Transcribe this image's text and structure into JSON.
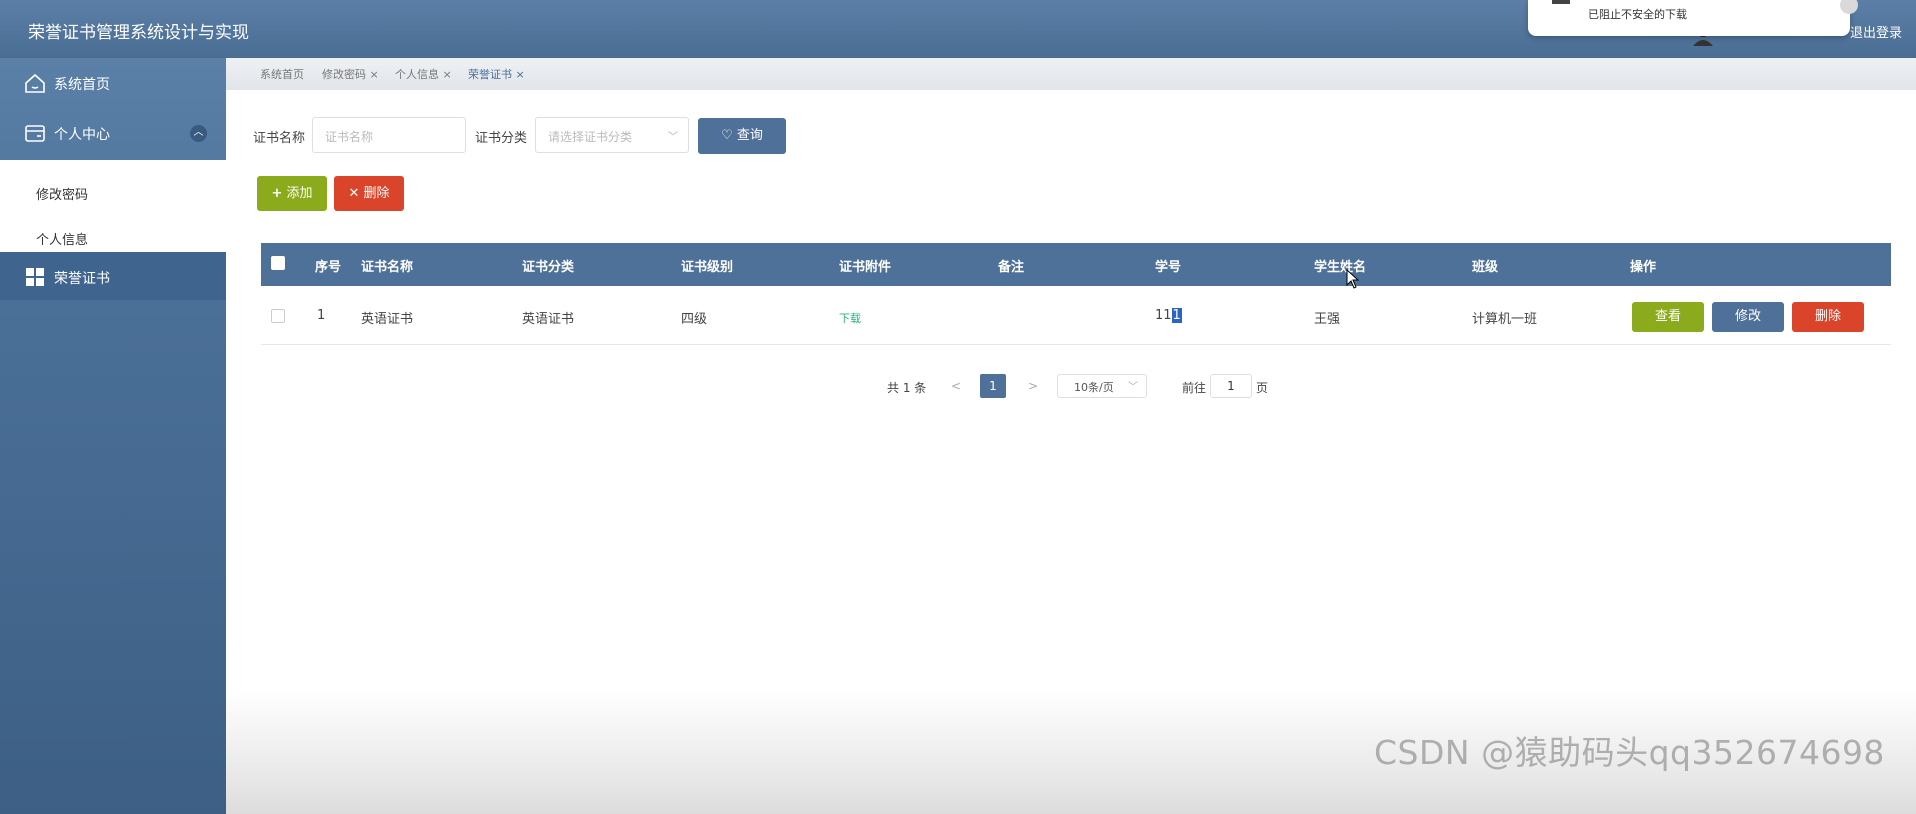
{
  "app": {
    "title": "荣誉证书管理系统设计与实现",
    "logout": "退出登录",
    "popup_text": "已阻止不安全的下载"
  },
  "sidebar": {
    "home": "系统首页",
    "personal_center": "个人中心",
    "sub_items": [
      "修改密码",
      "个人信息"
    ],
    "certificates": "荣誉证书"
  },
  "tabs": [
    {
      "label": "系统首页"
    },
    {
      "label": "修改密码 ×"
    },
    {
      "label": "个人信息 ×"
    },
    {
      "label": "荣誉证书 ×"
    }
  ],
  "search": {
    "name_label": "证书名称",
    "name_placeholder": "证书名称",
    "category_label": "证书分类",
    "category_placeholder": "请选择证书分类",
    "query_button": "查询"
  },
  "actions": {
    "add": "添加",
    "delete": "删除"
  },
  "table": {
    "headers": [
      "序号",
      "证书名称",
      "证书分类",
      "证书级别",
      "证书附件",
      "备注",
      "学号",
      "学生姓名",
      "班级",
      "操作"
    ],
    "rows": [
      {
        "index": "1",
        "name": "英语证书",
        "category": "英语证书",
        "level": "四级",
        "attachment": "下载",
        "note": "",
        "student_id_a": "11",
        "student_id_b": "1",
        "student_name": "王强",
        "class": "计算机一班",
        "view": "查看",
        "edit": "修改",
        "remove": "删除"
      }
    ]
  },
  "pagination": {
    "total": "共 1 条",
    "prev": "<",
    "current": "1",
    "next": ">",
    "page_size": "10条/页",
    "goto_label": "前往",
    "goto_value": "1",
    "page_suffix": "页"
  },
  "watermark": "CSDN @猿助码头qq352674698",
  "colors": {
    "header": "#5b7fa6",
    "sidebar": "#4a6f97",
    "primary": "#4f7199",
    "success": "#8cab1c",
    "danger": "#d9442a",
    "link": "#2db37a"
  }
}
